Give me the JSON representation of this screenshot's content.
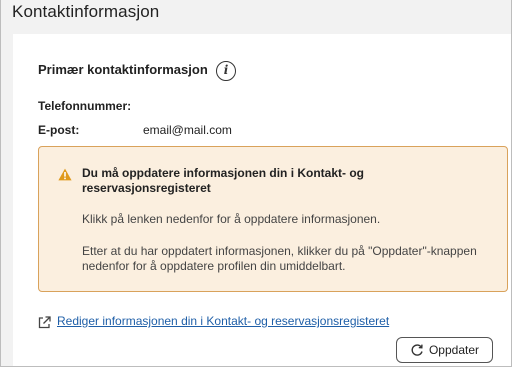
{
  "page": {
    "title": "Kontaktinformasjon"
  },
  "contact": {
    "heading": "Primær kontaktinformasjon",
    "info_icon_glyph": "i",
    "phone_label": "Telefonnummer:",
    "phone_value": "",
    "email_label": "E-post:",
    "email_value": "email@mail.com"
  },
  "alert": {
    "icon": "warning-icon",
    "accent_color": "#d9a25b",
    "background_color": "#fbefdf",
    "title": "Du må oppdatere informasjonen din i Kontakt- og reservasjonsregisteret",
    "text_1": "Klikk på lenken nedenfor for å oppdatere informasjonen.",
    "text_2": "Etter at du har oppdatert informasjonen, klikker du på \"Oppdater\"-knappen nedenfor for å oppdatere profilen din umiddelbart."
  },
  "actions": {
    "edit_link_label": "Rediger informasjonen din i Kontakt- og reservasjonsregisteret",
    "edit_link_icon": "external-link-icon",
    "update_button_label": "Oppdater",
    "update_button_icon": "refresh-icon",
    "link_color": "#1f5fa8"
  }
}
